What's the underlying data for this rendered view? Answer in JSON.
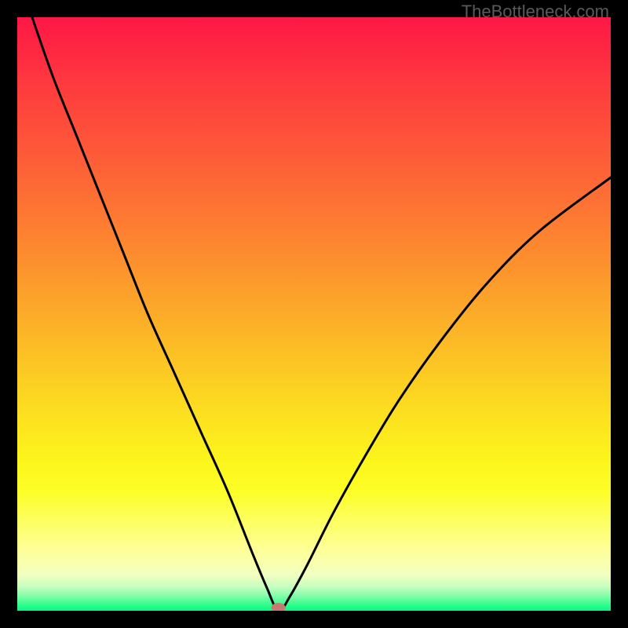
{
  "watermark": "TheBottleneck.com",
  "chart_data": {
    "type": "line",
    "title": "",
    "xlabel": "",
    "ylabel": "",
    "x_range": [
      0,
      100
    ],
    "y_range": [
      0,
      100
    ],
    "minimum_x": 44,
    "marker": {
      "x": 44,
      "y": 0,
      "color": "#c77a72"
    },
    "series": [
      {
        "name": "bottleneck-curve",
        "color": "#000000",
        "points": [
          {
            "x": 2.5,
            "y": 100
          },
          {
            "x": 6,
            "y": 90
          },
          {
            "x": 10,
            "y": 80
          },
          {
            "x": 14,
            "y": 70
          },
          {
            "x": 18,
            "y": 60
          },
          {
            "x": 22,
            "y": 50
          },
          {
            "x": 26.5,
            "y": 40
          },
          {
            "x": 31,
            "y": 30
          },
          {
            "x": 35.5,
            "y": 20
          },
          {
            "x": 39.5,
            "y": 10
          },
          {
            "x": 42,
            "y": 4
          },
          {
            "x": 44,
            "y": 0
          },
          {
            "x": 46,
            "y": 2.5
          },
          {
            "x": 49,
            "y": 8
          },
          {
            "x": 53,
            "y": 16
          },
          {
            "x": 58,
            "y": 25
          },
          {
            "x": 64,
            "y": 35
          },
          {
            "x": 71,
            "y": 45
          },
          {
            "x": 79,
            "y": 55
          },
          {
            "x": 88,
            "y": 64
          },
          {
            "x": 100,
            "y": 73
          }
        ]
      }
    ],
    "gradient_stops": [
      {
        "offset": 0.0,
        "color": "#fe1745"
      },
      {
        "offset": 0.12,
        "color": "#fe3c3e"
      },
      {
        "offset": 0.25,
        "color": "#fd6037"
      },
      {
        "offset": 0.38,
        "color": "#fd8630"
      },
      {
        "offset": 0.5,
        "color": "#fcab29"
      },
      {
        "offset": 0.62,
        "color": "#fcd122"
      },
      {
        "offset": 0.75,
        "color": "#fcf61c"
      },
      {
        "offset": 0.8,
        "color": "#fcfe27"
      },
      {
        "offset": 0.85,
        "color": "#fdff62"
      },
      {
        "offset": 0.9,
        "color": "#feff9a"
      },
      {
        "offset": 0.94,
        "color": "#f1ffc1"
      },
      {
        "offset": 0.96,
        "color": "#c5fec0"
      },
      {
        "offset": 0.975,
        "color": "#82fda7"
      },
      {
        "offset": 0.99,
        "color": "#32fc8e"
      },
      {
        "offset": 1.0,
        "color": "#04fb7f"
      }
    ]
  }
}
